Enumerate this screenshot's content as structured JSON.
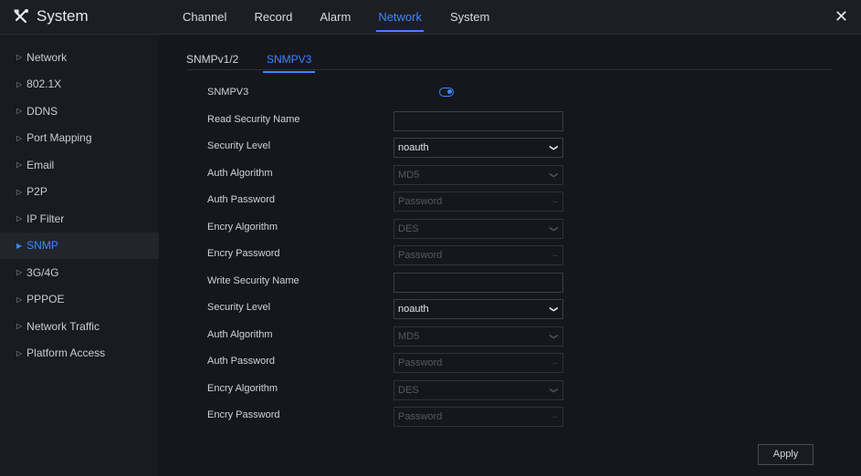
{
  "app": {
    "title": "System",
    "logo_icon": "tools-icon"
  },
  "nav": {
    "tabs": [
      "Channel",
      "Record",
      "Alarm",
      "Network",
      "System"
    ],
    "active": "Network"
  },
  "close_icon": "close-icon",
  "sidebar": {
    "items": [
      "Network",
      "802.1X",
      "DDNS",
      "Port Mapping",
      "Email",
      "P2P",
      "IP Filter",
      "SNMP",
      "3G/4G",
      "PPPOE",
      "Network Traffic",
      "Platform Access"
    ],
    "active": "SNMP"
  },
  "subtabs": {
    "items": [
      "SNMPv1/2",
      "SNMPV3"
    ],
    "active": "SNMPV3"
  },
  "form": {
    "snmpv3": {
      "label": "SNMPV3",
      "enabled": true
    },
    "read_security_name": {
      "label": "Read Security Name",
      "value": ""
    },
    "read_security_level": {
      "label": "Security Level",
      "value": "noauth"
    },
    "read_auth_algorithm": {
      "label": "Auth Algorithm",
      "value": "MD5"
    },
    "read_auth_password": {
      "label": "Auth Password",
      "placeholder": "Password"
    },
    "read_encry_algorithm": {
      "label": "Encry Algorithm",
      "value": "DES"
    },
    "read_encry_password": {
      "label": "Encry Password",
      "placeholder": "Password"
    },
    "write_security_name": {
      "label": "Write Security Name",
      "value": ""
    },
    "write_security_level": {
      "label": "Security Level",
      "value": "noauth"
    },
    "write_auth_algorithm": {
      "label": "Auth Algorithm",
      "value": "MD5"
    },
    "write_auth_password": {
      "label": "Auth Password",
      "placeholder": "Password"
    },
    "write_encry_algorithm": {
      "label": "Encry Algorithm",
      "value": "DES"
    },
    "write_encry_password": {
      "label": "Encry Password",
      "placeholder": "Password"
    }
  },
  "apply_label": "Apply",
  "colors": {
    "accent": "#3d86ff",
    "background": "#16171c",
    "sidebar": "#1a1b20",
    "disabled_text": "#55585f"
  }
}
